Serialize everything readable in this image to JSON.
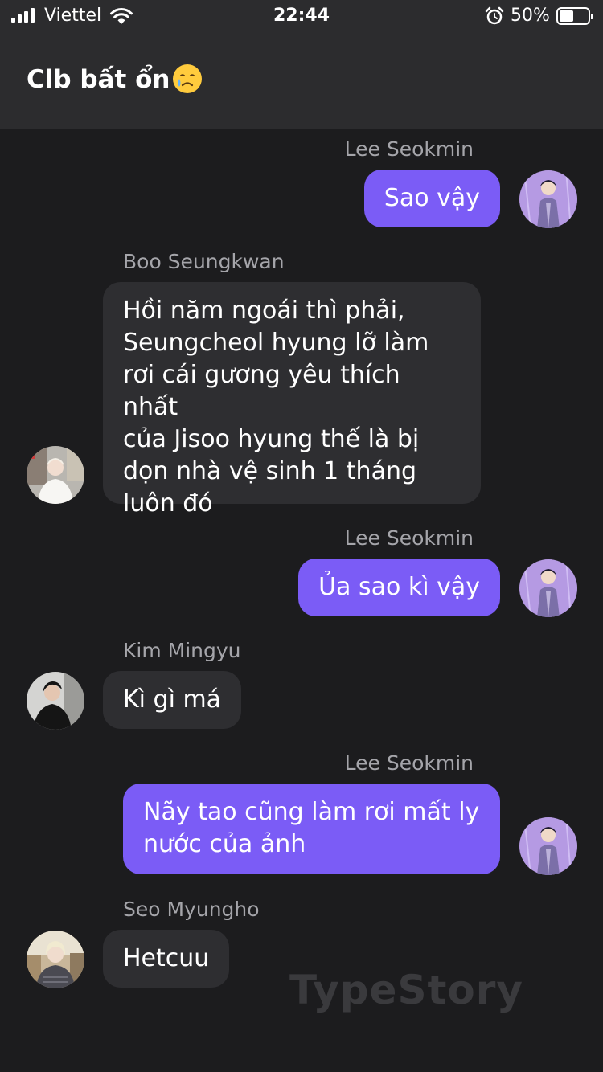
{
  "status_bar": {
    "carrier": "Viettel",
    "time": "22:44",
    "battery_percent": "50%",
    "battery_level": 0.5,
    "icons": [
      "signal-icon",
      "wifi-icon",
      "alarm-icon",
      "battery-icon"
    ]
  },
  "chat": {
    "title": "Clb bất ổn",
    "title_emoji": "crying-face-emoji"
  },
  "messages": [
    {
      "sender": "Lee Seokmin",
      "text": "Sao vậy",
      "direction": "outgoing"
    },
    {
      "sender": "Boo Seungkwan",
      "lines": [
        "Hồi năm ngoái thì phải,",
        "Seungcheol hyung lỡ làm",
        "rơi cái gương yêu thích nhất",
        "của Jisoo hyung thế là bị",
        "dọn nhà vệ sinh 1 tháng",
        "luôn đó"
      ],
      "direction": "incoming"
    },
    {
      "sender": "Lee Seokmin",
      "text": "Ủa sao kì vậy",
      "direction": "outgoing"
    },
    {
      "sender": "Kim Mingyu",
      "text": "Kì gì má",
      "direction": "incoming"
    },
    {
      "sender": "Lee Seokmin",
      "lines": [
        "Nãy tao cũng làm rơi mất ly",
        "nước của ảnh"
      ],
      "direction": "outgoing"
    },
    {
      "sender": "Seo Myungho",
      "text": "Hetcuu",
      "direction": "incoming"
    }
  ],
  "watermark": "TypeStory",
  "colors": {
    "background": "#1c1c1e",
    "header": "#2c2c2e",
    "outgoing_bubble": "#7b5cf6",
    "incoming_bubble": "#2e2e31",
    "sender_name": "#a5a5aa"
  }
}
